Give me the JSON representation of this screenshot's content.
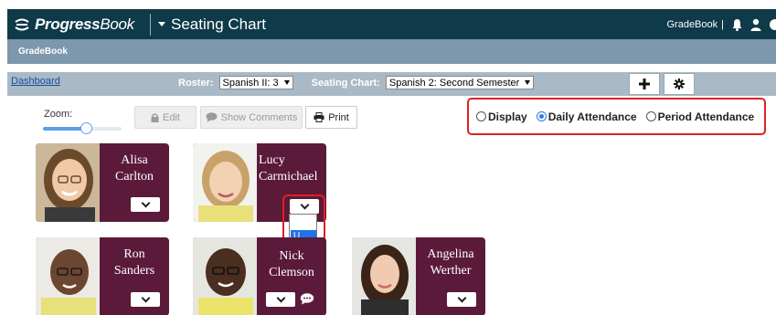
{
  "header": {
    "logo_bold": "Progress",
    "logo_light": "Book",
    "app_title": "Seating Chart",
    "gradebook_link": "GradeBook",
    "sep": "|"
  },
  "subbar": {
    "title": "GradeBook"
  },
  "toolbar": {
    "dashboard_link": "Dashboard",
    "roster_label": "Roster:",
    "roster_value": "Spanish II: 3",
    "seating_label": "Seating Chart:",
    "seating_value": "Spanish 2: Second Semester"
  },
  "controls": {
    "zoom_label": "Zoom:",
    "zoom_level": 0.55,
    "edit_label": "Edit",
    "comments_label": "Show Comments",
    "print_label": "Print"
  },
  "attendance": {
    "options": [
      {
        "label": "Display",
        "checked": false
      },
      {
        "label": "Daily Attendance",
        "checked": true
      },
      {
        "label": "Period Attendance",
        "checked": false
      }
    ]
  },
  "students": [
    {
      "first": "Alisa",
      "last": "Carlton"
    },
    {
      "first": "Lucy",
      "last": "Carmichael"
    },
    {
      "first": "Ron",
      "last": "Sanders"
    },
    {
      "first": "Nick",
      "last": "Clemson"
    },
    {
      "first": "Angelina",
      "last": "Werther"
    }
  ],
  "open_dropdown": {
    "option": "U"
  },
  "colors": {
    "topbar": "#0f3a4a",
    "subbar": "#7d97ac",
    "toolbar": "#a9b9c6",
    "card": "#5b1a3a",
    "highlight": "#e02020",
    "selected": "#1e73e8"
  }
}
